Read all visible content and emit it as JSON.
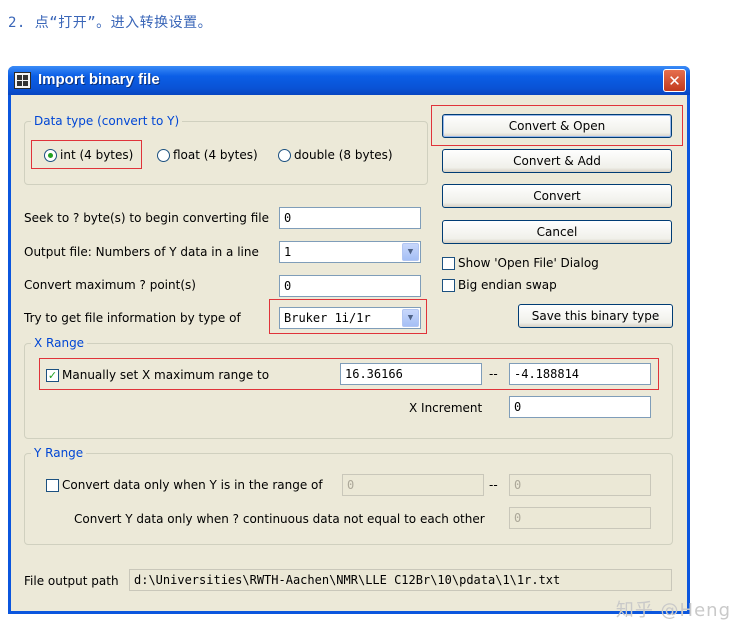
{
  "caption": "2. 点“打开”。进入转换设置。",
  "dialog": {
    "title": "Import binary file",
    "close_glyph": "✕",
    "data_type": {
      "legend": "Data type (convert to Y)",
      "options": [
        "int (4 bytes)",
        "float (4 bytes)",
        "double (8 bytes)"
      ],
      "selected": "int (4 bytes)"
    },
    "seek": {
      "label": "Seek to ? byte(s) to begin converting file",
      "value": "0"
    },
    "output_file": {
      "label": "Output file: Numbers of Y data in a line",
      "value": "1"
    },
    "convert_max": {
      "label": "Convert maximum ? point(s)",
      "value": "0"
    },
    "file_info": {
      "label": "Try to get file information by type of",
      "value": "Bruker 1i/1r"
    },
    "buttons": {
      "convert_open": "Convert & Open",
      "convert_add": "Convert & Add",
      "convert": "Convert",
      "cancel": "Cancel",
      "save_type": "Save this binary type"
    },
    "show_open_file": {
      "label": "Show 'Open File' Dialog",
      "checked": false
    },
    "big_endian": {
      "label": "Big endian swap",
      "checked": false
    },
    "x_range": {
      "legend": "X Range",
      "manual_label": "Manually set X maximum range to",
      "manual_checked": true,
      "from": "16.36166",
      "separator": "--",
      "to": "-4.188814",
      "increment_label": "X Increment",
      "increment": "0"
    },
    "y_range": {
      "legend": "Y Range",
      "convert_only_label": "Convert data only when Y is in the range of",
      "convert_only_checked": false,
      "from": "0",
      "separator": "--",
      "to": "0",
      "continuous_label": "Convert Y data only when ? continuous data not equal to each other",
      "continuous": "0"
    },
    "file_output": {
      "label": "File output path",
      "value": "d:\\Universities\\RWTH-Aachen\\NMR\\LLE C12Br\\10\\pdata\\1\\1r.txt"
    }
  },
  "watermark": "知乎 @Heng",
  "colors": {
    "title_bar": "#0a53d6",
    "dialog_bg": "#ece9d8",
    "legend_text": "#0046d5",
    "highlight": "#e0333a",
    "caption": "#3a66b8"
  }
}
